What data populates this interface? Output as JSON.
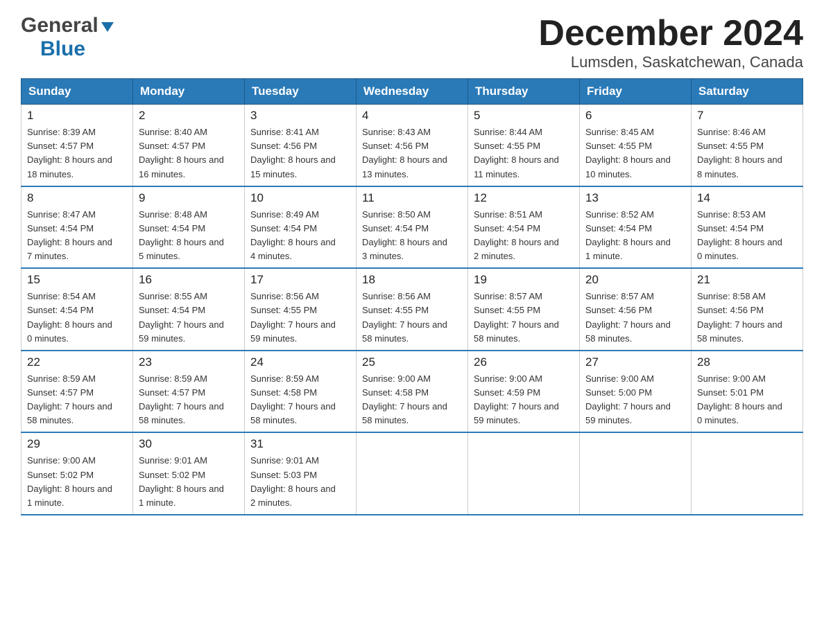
{
  "header": {
    "logo": {
      "general_text": "General",
      "blue_text": "Blue"
    },
    "title": "December 2024",
    "subtitle": "Lumsden, Saskatchewan, Canada"
  },
  "calendar": {
    "weekdays": [
      "Sunday",
      "Monday",
      "Tuesday",
      "Wednesday",
      "Thursday",
      "Friday",
      "Saturday"
    ],
    "weeks": [
      [
        {
          "day": "1",
          "sunrise": "8:39 AM",
          "sunset": "4:57 PM",
          "daylight": "8 hours and 18 minutes."
        },
        {
          "day": "2",
          "sunrise": "8:40 AM",
          "sunset": "4:57 PM",
          "daylight": "8 hours and 16 minutes."
        },
        {
          "day": "3",
          "sunrise": "8:41 AM",
          "sunset": "4:56 PM",
          "daylight": "8 hours and 15 minutes."
        },
        {
          "day": "4",
          "sunrise": "8:43 AM",
          "sunset": "4:56 PM",
          "daylight": "8 hours and 13 minutes."
        },
        {
          "day": "5",
          "sunrise": "8:44 AM",
          "sunset": "4:55 PM",
          "daylight": "8 hours and 11 minutes."
        },
        {
          "day": "6",
          "sunrise": "8:45 AM",
          "sunset": "4:55 PM",
          "daylight": "8 hours and 10 minutes."
        },
        {
          "day": "7",
          "sunrise": "8:46 AM",
          "sunset": "4:55 PM",
          "daylight": "8 hours and 8 minutes."
        }
      ],
      [
        {
          "day": "8",
          "sunrise": "8:47 AM",
          "sunset": "4:54 PM",
          "daylight": "8 hours and 7 minutes."
        },
        {
          "day": "9",
          "sunrise": "8:48 AM",
          "sunset": "4:54 PM",
          "daylight": "8 hours and 5 minutes."
        },
        {
          "day": "10",
          "sunrise": "8:49 AM",
          "sunset": "4:54 PM",
          "daylight": "8 hours and 4 minutes."
        },
        {
          "day": "11",
          "sunrise": "8:50 AM",
          "sunset": "4:54 PM",
          "daylight": "8 hours and 3 minutes."
        },
        {
          "day": "12",
          "sunrise": "8:51 AM",
          "sunset": "4:54 PM",
          "daylight": "8 hours and 2 minutes."
        },
        {
          "day": "13",
          "sunrise": "8:52 AM",
          "sunset": "4:54 PM",
          "daylight": "8 hours and 1 minute."
        },
        {
          "day": "14",
          "sunrise": "8:53 AM",
          "sunset": "4:54 PM",
          "daylight": "8 hours and 0 minutes."
        }
      ],
      [
        {
          "day": "15",
          "sunrise": "8:54 AM",
          "sunset": "4:54 PM",
          "daylight": "8 hours and 0 minutes."
        },
        {
          "day": "16",
          "sunrise": "8:55 AM",
          "sunset": "4:54 PM",
          "daylight": "7 hours and 59 minutes."
        },
        {
          "day": "17",
          "sunrise": "8:56 AM",
          "sunset": "4:55 PM",
          "daylight": "7 hours and 59 minutes."
        },
        {
          "day": "18",
          "sunrise": "8:56 AM",
          "sunset": "4:55 PM",
          "daylight": "7 hours and 58 minutes."
        },
        {
          "day": "19",
          "sunrise": "8:57 AM",
          "sunset": "4:55 PM",
          "daylight": "7 hours and 58 minutes."
        },
        {
          "day": "20",
          "sunrise": "8:57 AM",
          "sunset": "4:56 PM",
          "daylight": "7 hours and 58 minutes."
        },
        {
          "day": "21",
          "sunrise": "8:58 AM",
          "sunset": "4:56 PM",
          "daylight": "7 hours and 58 minutes."
        }
      ],
      [
        {
          "day": "22",
          "sunrise": "8:59 AM",
          "sunset": "4:57 PM",
          "daylight": "7 hours and 58 minutes."
        },
        {
          "day": "23",
          "sunrise": "8:59 AM",
          "sunset": "4:57 PM",
          "daylight": "7 hours and 58 minutes."
        },
        {
          "day": "24",
          "sunrise": "8:59 AM",
          "sunset": "4:58 PM",
          "daylight": "7 hours and 58 minutes."
        },
        {
          "day": "25",
          "sunrise": "9:00 AM",
          "sunset": "4:58 PM",
          "daylight": "7 hours and 58 minutes."
        },
        {
          "day": "26",
          "sunrise": "9:00 AM",
          "sunset": "4:59 PM",
          "daylight": "7 hours and 59 minutes."
        },
        {
          "day": "27",
          "sunrise": "9:00 AM",
          "sunset": "5:00 PM",
          "daylight": "7 hours and 59 minutes."
        },
        {
          "day": "28",
          "sunrise": "9:00 AM",
          "sunset": "5:01 PM",
          "daylight": "8 hours and 0 minutes."
        }
      ],
      [
        {
          "day": "29",
          "sunrise": "9:00 AM",
          "sunset": "5:02 PM",
          "daylight": "8 hours and 1 minute."
        },
        {
          "day": "30",
          "sunrise": "9:01 AM",
          "sunset": "5:02 PM",
          "daylight": "8 hours and 1 minute."
        },
        {
          "day": "31",
          "sunrise": "9:01 AM",
          "sunset": "5:03 PM",
          "daylight": "8 hours and 2 minutes."
        },
        null,
        null,
        null,
        null
      ]
    ]
  }
}
